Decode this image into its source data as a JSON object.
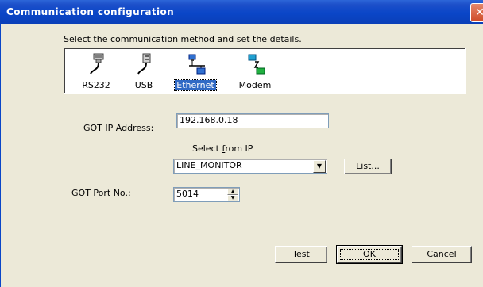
{
  "window": {
    "title": "Communication configuration",
    "close_glyph": "✕"
  },
  "instruction": "Select the communication method and set the details.",
  "methods": [
    {
      "label": "RS232",
      "icon": "rs232-cable-icon",
      "selected": false
    },
    {
      "label": "USB",
      "icon": "usb-cable-icon",
      "selected": false
    },
    {
      "label": "Ethernet",
      "icon": "ethernet-network-icon",
      "selected": true
    },
    {
      "label": "Modem",
      "icon": "modem-network-icon",
      "selected": false
    }
  ],
  "ip": {
    "label_pre": "GOT ",
    "label_mnemonic": "I",
    "label_post": "P Address:",
    "value": "192.168.0.18"
  },
  "select_from_ip": {
    "label_pre": "Select ",
    "label_mnemonic": "f",
    "label_post": "rom IP",
    "value": "LINE_MONITOR"
  },
  "list_button": {
    "label_mnemonic": "L",
    "label_post": "ist..."
  },
  "port": {
    "label_mnemonic": "G",
    "label_post": "OT Port No.:",
    "value": "5014"
  },
  "buttons": {
    "test_mnemonic": "T",
    "test_post": "est",
    "ok_mnemonic": "O",
    "ok_post": "K",
    "cancel_mnemonic": "C",
    "cancel_post": "ancel"
  }
}
